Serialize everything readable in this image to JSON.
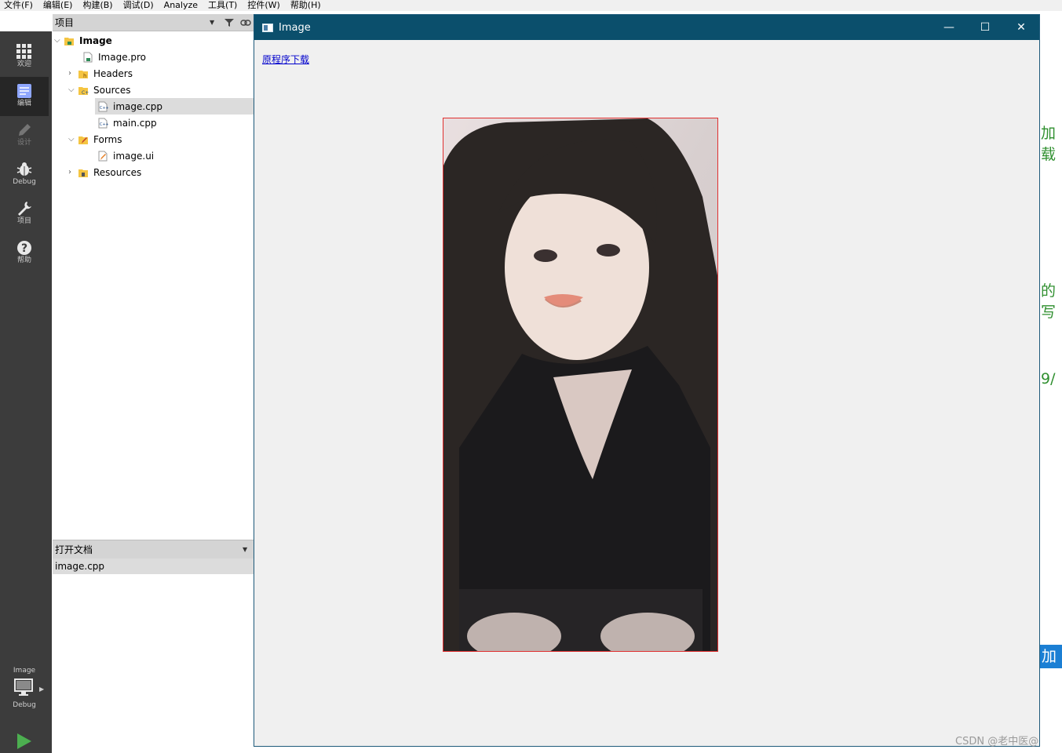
{
  "menu": [
    "文件(F)",
    "编辑(E)",
    "构建(B)",
    "调试(D)",
    "Analyze",
    "工具(T)",
    "控件(W)",
    "帮助(H)"
  ],
  "modes": [
    {
      "label": "欢迎",
      "icon": "grid-icon"
    },
    {
      "label": "编辑",
      "icon": "document-edit-icon"
    },
    {
      "label": "设计",
      "icon": "pencil-icon"
    },
    {
      "label": "Debug",
      "icon": "bug-icon"
    },
    {
      "label": "项目",
      "icon": "wrench-icon"
    },
    {
      "label": "帮助",
      "icon": "help-icon"
    }
  ],
  "target": {
    "project": "Image",
    "config": "Debug"
  },
  "project_pane": {
    "title": "项目",
    "tree": [
      {
        "label": "Image",
        "level": 0,
        "arrow": "open"
      },
      {
        "label": "Image.pro",
        "level": 1,
        "arrow": ""
      },
      {
        "label": "Headers",
        "level": 1,
        "arrow": "closed"
      },
      {
        "label": "Sources",
        "level": 1,
        "arrow": "open"
      },
      {
        "label": "image.cpp",
        "level": 2,
        "arrow": ""
      },
      {
        "label": "main.cpp",
        "level": 2,
        "arrow": ""
      },
      {
        "label": "Forms",
        "level": 1,
        "arrow": "open"
      },
      {
        "label": "image.ui",
        "level": 2,
        "arrow": ""
      },
      {
        "label": "Resources",
        "level": 1,
        "arrow": "closed"
      }
    ]
  },
  "open_docs": {
    "title": "打开文档",
    "items": [
      "image.cpp"
    ]
  },
  "editor_glimpses": [
    "加载",
    "的写",
    "9/",
    "加载"
  ],
  "window": {
    "title": "Image",
    "buttons": {
      "minimize": "—",
      "maximize": "☐",
      "close": "✕"
    },
    "link_text": "原程序下载"
  },
  "watermark": "CSDN @老中医@"
}
